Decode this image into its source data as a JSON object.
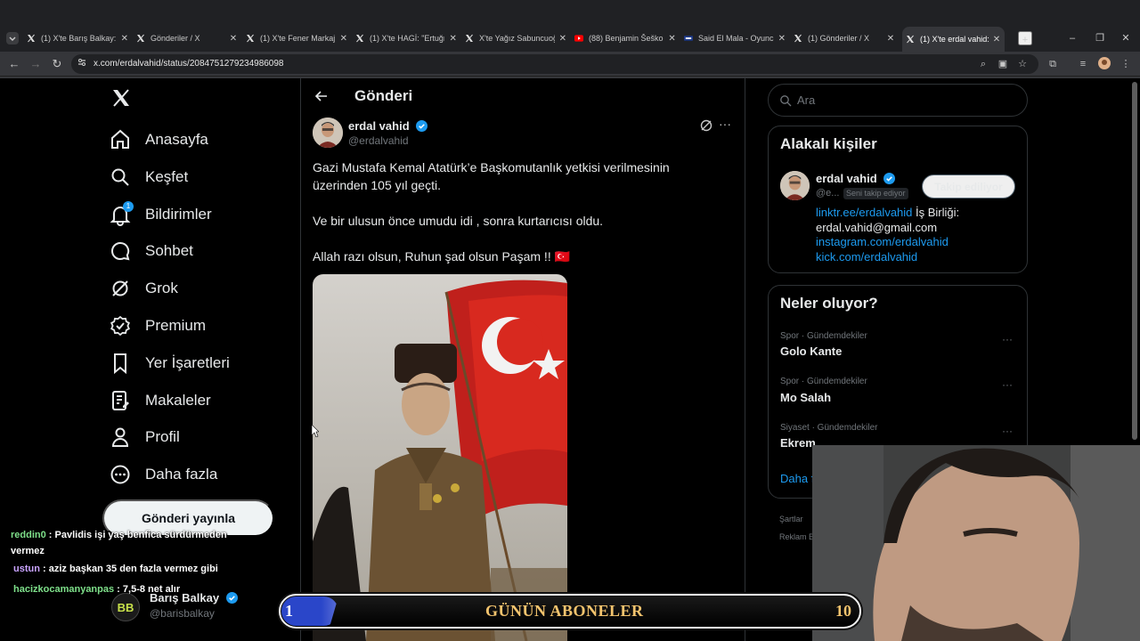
{
  "browser": {
    "tabs": [
      {
        "favicon": "x-icon",
        "title": "(1) X'te Barış Balkay: \"…",
        "active": false
      },
      {
        "favicon": "x-icon",
        "title": "Gönderiler / X",
        "active": false
      },
      {
        "favicon": "x-icon",
        "title": "(1) X'te Fener Markaj: …",
        "active": false
      },
      {
        "favicon": "x-icon",
        "title": "(1) X'te HAGİ: \"Ertuğr…",
        "active": false
      },
      {
        "favicon": "x-icon",
        "title": "X'te Yağız Sabuncuoğ…",
        "active": false
      },
      {
        "favicon": "youtube-icon",
        "title": "(88) Benjamin Šeško…",
        "active": false
      },
      {
        "favicon": "fm-icon",
        "title": "Said El Mala - Oyuncu…",
        "active": false
      },
      {
        "favicon": "x-icon",
        "title": "(1) Gönderiler / X",
        "active": false
      },
      {
        "favicon": "x-icon",
        "title": "(1) X'te erdal vahid: \"…",
        "active": true
      }
    ],
    "url": "x.com/erdalvahid/status/2084751279234986098"
  },
  "nav": {
    "items": [
      {
        "label": "Anasayfa",
        "icon": "home-icon"
      },
      {
        "label": "Keşfet",
        "icon": "search-icon"
      },
      {
        "label": "Bildirimler",
        "icon": "bell-icon",
        "badge": "1"
      },
      {
        "label": "Sohbet",
        "icon": "chat-icon"
      },
      {
        "label": "Grok",
        "icon": "grok-icon"
      },
      {
        "label": "Premium",
        "icon": "premium-icon"
      },
      {
        "label": "Yer İşaretleri",
        "icon": "bookmark-icon"
      },
      {
        "label": "Makaleler",
        "icon": "article-icon"
      },
      {
        "label": "Profil",
        "icon": "profile-icon"
      },
      {
        "label": "Daha fazla",
        "icon": "more-circle-icon"
      }
    ],
    "post_button": "Gönderi yayınla",
    "account": {
      "name": "Barış Balkay",
      "handle": "@barisbalkay",
      "avatar_text": "BB"
    }
  },
  "post": {
    "header_title": "Gönderi",
    "author_name": "erdal vahid",
    "author_handle": "@erdalvahid",
    "lines": [
      "Gazi Mustafa Kemal Atatürk’e Başkomutanlık yetkisi verilmesinin",
      "üzerinden 105 yıl geçti.",
      "Ve bir ulusun önce umudu idi , sonra kurtarıcısı oldu.",
      "Allah razı olsun, Ruhun şad olsun Paşam !! 🇹🇷"
    ]
  },
  "sidebar": {
    "search_placeholder": "Ara",
    "related": {
      "title": "Alakalı kişiler",
      "name": "erdal vahid",
      "handle": "@e...",
      "follows_you": "Seni takip ediyor",
      "follow_button": "Takip ediliyor",
      "bio_link1": "linktr.ee/erdalvahid",
      "bio_text1": " İş Birliği:",
      "bio_text2": "erdal.vahid@gmail.com",
      "bio_link2": "instagram.com/erdalvahid",
      "bio_link3": "kick.com/erdalvahid"
    },
    "trends": {
      "title": "Neler oluyor?",
      "items": [
        {
          "meta": "Spor · Gündemdekiler",
          "name": "Golo Kante"
        },
        {
          "meta": "Spor · Gündemdekiler",
          "name": "Mo Salah"
        },
        {
          "meta": "Siyaset · Gündemdekiler",
          "name": "Ekrem"
        }
      ],
      "show_more": "Daha f"
    },
    "footer": [
      "Şartlar",
      "Reklam B"
    ]
  },
  "overlay": {
    "chat": [
      {
        "user": "reddin0",
        "user_color": "#7ee08a",
        "text": " : Pavlidis işi yaş benfica sürdürmeden",
        "cont": "vermez"
      },
      {
        "user": "ustun",
        "user_color": "#c9a3ff",
        "text": " : aziz başkan 35 den fazla vermez gibi"
      },
      {
        "user": "hacizkocamanyanpas",
        "user_color": "#7ee08a",
        "text": " : 7,5-8 net alır"
      }
    ],
    "subs_bar": {
      "left": "1",
      "title": "GÜNÜN ABONELER",
      "right": "10"
    }
  },
  "colors": {
    "accent": "#1d9bf0",
    "background": "#000000",
    "border": "#2f3336",
    "muted": "#71767b"
  }
}
